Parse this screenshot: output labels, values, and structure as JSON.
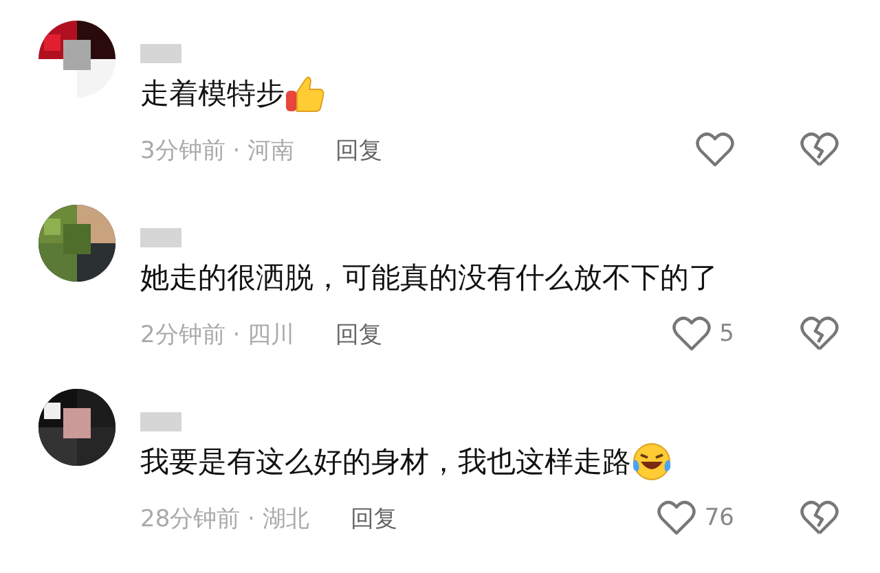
{
  "comments": [
    {
      "text": "走着模特步",
      "kind": "thumbs-up",
      "meta": "3分钟前 · 河南",
      "reply": "回复"
    },
    {
      "text": "她走的很洒脱，可能真的没有什么放不下的了",
      "kind": "plain",
      "meta": "2分钟前 · 四川",
      "reply": "回复",
      "likes": "5"
    },
    {
      "text": "我要是有这么好的身材，我也这样走路",
      "kind": "laugh-cry",
      "meta": "28分钟前 · 湖北",
      "reply": "回复",
      "likes": "76"
    }
  ]
}
